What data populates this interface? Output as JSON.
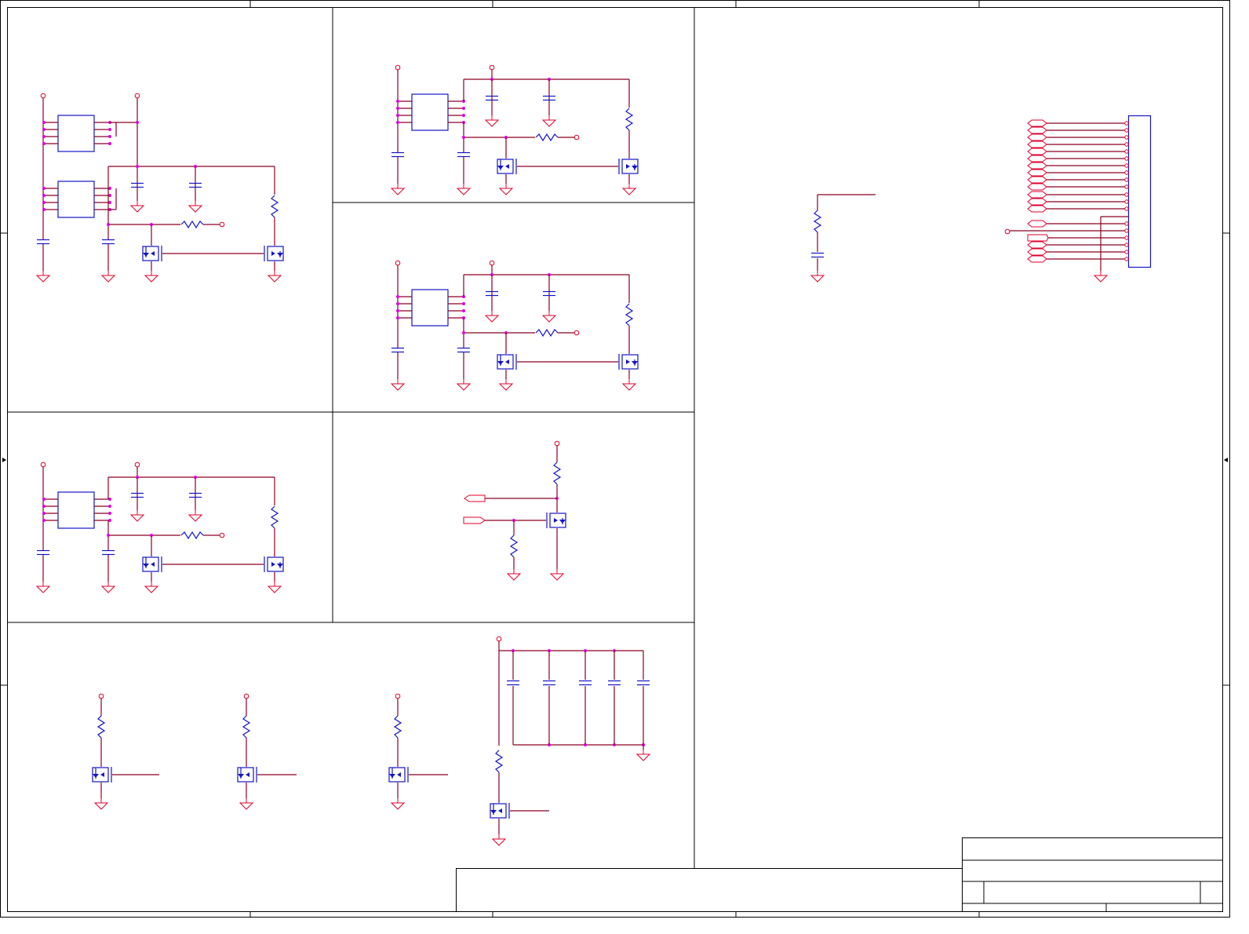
{
  "title_block": {
    "title": "",
    "document_number": "",
    "revision": "",
    "sheet": "",
    "notes": ""
  }
}
